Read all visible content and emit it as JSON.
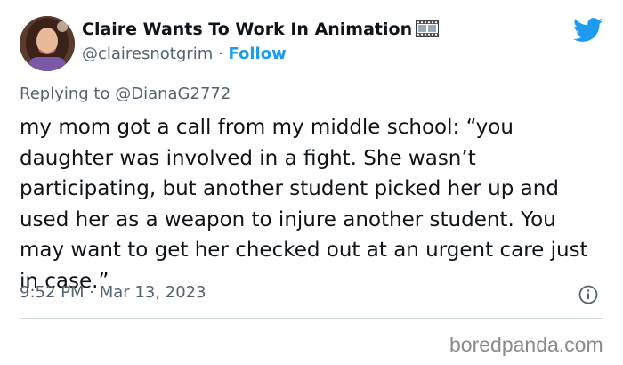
{
  "author": {
    "display_name": "Claire Wants To Work In Animation",
    "title_icon": "film-strip-icon",
    "handle": "@clairesnotgrim",
    "separator": "·",
    "follow_label": "Follow",
    "avatar_icon": "profile-photo"
  },
  "brand": {
    "icon": "twitter-bird-icon",
    "color": "#1d9bf0"
  },
  "reply": {
    "prefix": "Replying to",
    "mention": "@DianaG2772"
  },
  "tweet": {
    "text": "my mom got a call from my middle school: “you daughter was involved in a fight. She wasn’t participating, but another student picked her up and used her as a weapon to injure another student. You may want to get her checked out at an urgent care just in case.”"
  },
  "meta": {
    "time": "9:52 PM",
    "separator": "·",
    "date": "Mar 13, 2023",
    "info_icon": "info-icon"
  },
  "watermark": "boredpanda.com",
  "colors": {
    "text": "#0f1419",
    "muted": "#536471",
    "link": "#1d9bf0",
    "divider": "#cfd9de"
  }
}
